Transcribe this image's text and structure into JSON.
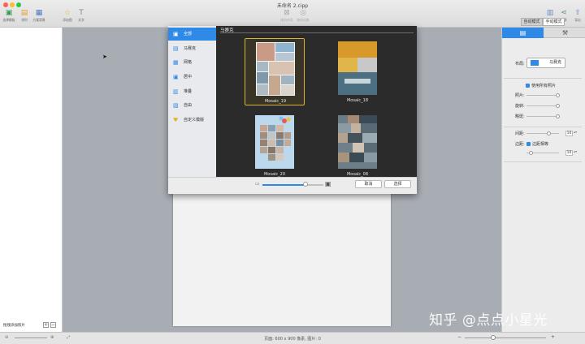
{
  "window": {
    "title": "未命名 2.cipp"
  },
  "toolbar": {
    "left_tools": [
      "选择模板",
      "排列",
      "方案背景"
    ],
    "mid_tools": [
      "添加图",
      "文字"
    ],
    "center_tools": [
      "随机布局",
      "随机风格"
    ],
    "right_tools": [
      "布局",
      "分享",
      "导出"
    ]
  },
  "left_panel": {
    "add_photos_label": "拖拽添加照片",
    "add_symbol": "+",
    "remove_symbol": "−"
  },
  "statusbar": {
    "page_info": "页面: 600 x 900 像素, 图片: 0",
    "zoom_level": 0.35
  },
  "dialog": {
    "categories": [
      {
        "label": "全部",
        "icon": "all-icon",
        "selected": true
      },
      {
        "label": "马赛克",
        "icon": "mosaic-icon",
        "selected": false
      },
      {
        "label": "网格",
        "icon": "grid-icon",
        "selected": false
      },
      {
        "label": "居中",
        "icon": "center-icon",
        "selected": false
      },
      {
        "label": "堆叠",
        "icon": "stack-icon",
        "selected": false
      },
      {
        "label": "自由",
        "icon": "free-icon",
        "selected": false
      },
      {
        "label": "自定义模版",
        "icon": "heart-icon",
        "selected": false
      }
    ],
    "heading": "马赛克",
    "templates": [
      {
        "name": "Mosaic_19",
        "selected": true
      },
      {
        "name": "Mosaic_18",
        "selected": false
      },
      {
        "name": "Mosaic_20",
        "selected": false
      },
      {
        "name": "Mosaic_08",
        "selected": false
      }
    ],
    "thumb_size_level": 0.7,
    "cancel_label": "取消",
    "ok_label": "选择"
  },
  "right_panel": {
    "tabs": [
      {
        "icon": "layout-icon",
        "active": true
      },
      {
        "icon": "tools-icon",
        "active": false
      }
    ],
    "mode_auto": "自动模式",
    "mode_manual": "手动模式",
    "layout_label": "布局:",
    "layout_value": "马赛克",
    "use_all_photos": "使用所有照片",
    "photos_label": "照片:",
    "rotation_label": "旋转:",
    "tilt_label": "略斑:",
    "spacing_label": "间距:",
    "spacing_value": "10",
    "border_label": "边距:",
    "border_equal": "边距相等",
    "border_value": "10"
  },
  "watermark": "知乎 @点点小星光"
}
